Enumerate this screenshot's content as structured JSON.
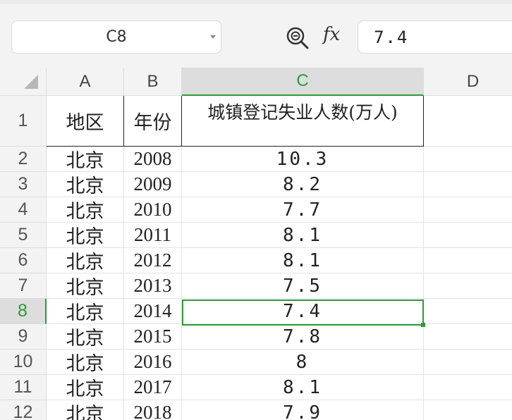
{
  "name_box": {
    "value": "C8"
  },
  "formula_bar": {
    "fx_label": "fx",
    "value": "7.4"
  },
  "columns": [
    "A",
    "B",
    "C",
    "D"
  ],
  "rows": [
    {
      "num": "1",
      "a": "地区",
      "b": "年份",
      "c": "城镇登记失业人数(万人)"
    },
    {
      "num": "2",
      "a": "北京",
      "b": "2008",
      "c": "10.3"
    },
    {
      "num": "3",
      "a": "北京",
      "b": "2009",
      "c": "8.2"
    },
    {
      "num": "4",
      "a": "北京",
      "b": "2010",
      "c": "7.7"
    },
    {
      "num": "5",
      "a": "北京",
      "b": "2011",
      "c": "8.1"
    },
    {
      "num": "6",
      "a": "北京",
      "b": "2012",
      "c": "8.1"
    },
    {
      "num": "7",
      "a": "北京",
      "b": "2013",
      "c": "7.5"
    },
    {
      "num": "8",
      "a": "北京",
      "b": "2014",
      "c": "7.4"
    },
    {
      "num": "9",
      "a": "北京",
      "b": "2015",
      "c": "7.8"
    },
    {
      "num": "10",
      "a": "北京",
      "b": "2016",
      "c": "8"
    },
    {
      "num": "11",
      "a": "北京",
      "b": "2017",
      "c": "8.1"
    },
    {
      "num": "12",
      "a": "北京",
      "b": "2018",
      "c": "7.9"
    }
  ],
  "selection": {
    "column": "C",
    "row": "8"
  },
  "colors": {
    "accent": "#2e9a36",
    "header_bg": "#f3f3f3",
    "selected_header_bg": "#dddddd"
  },
  "icons": {
    "zoom": "zoom-magnifier-icon",
    "dropdown": "chevron-down-icon"
  }
}
